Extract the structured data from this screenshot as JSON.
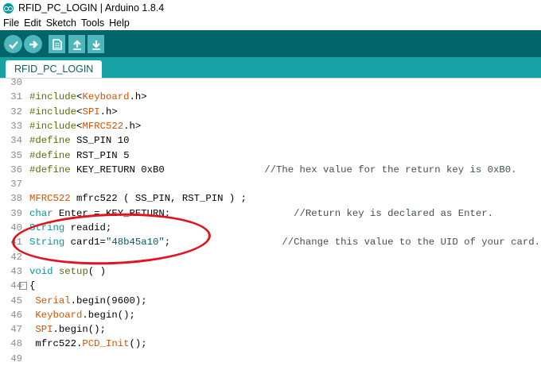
{
  "window": {
    "title": "RFID_PC_LOGIN | Arduino 1.8.4"
  },
  "menu": [
    "File",
    "Edit",
    "Sketch",
    "Tools",
    "Help"
  ],
  "toolbar": {
    "buttons": [
      {
        "name": "verify",
        "icon": "checkmark-icon"
      },
      {
        "name": "upload",
        "icon": "arrow-right-icon"
      },
      {
        "name": "new",
        "icon": "new-file-icon"
      },
      {
        "name": "open",
        "icon": "arrow-up-icon"
      },
      {
        "name": "save",
        "icon": "arrow-down-icon"
      }
    ]
  },
  "tab": {
    "label": "RFID_PC_LOGIN"
  },
  "colors": {
    "toolbar": "#006468",
    "tabbar": "#17a1a5",
    "button": "#4db7bb",
    "annotation": "#e2131f"
  },
  "editor": {
    "lines": [
      {
        "n": "30",
        "fold": "",
        "code": []
      },
      {
        "n": "31",
        "fold": "",
        "code": [
          [
            "kw",
            "#include"
          ],
          [
            "",
            "<"
          ],
          [
            "lib",
            "Keyboard"
          ],
          [
            "",
            ".h>"
          ]
        ]
      },
      {
        "n": "32",
        "fold": "",
        "code": [
          [
            "kw",
            "#include"
          ],
          [
            "",
            "<"
          ],
          [
            "lib",
            "SPI"
          ],
          [
            "",
            ".h>"
          ]
        ]
      },
      {
        "n": "33",
        "fold": "",
        "code": [
          [
            "kw",
            "#include"
          ],
          [
            "",
            "<"
          ],
          [
            "lib",
            "MFRC522"
          ],
          [
            "",
            ".h>"
          ]
        ]
      },
      {
        "n": "34",
        "fold": "",
        "code": [
          [
            "kw",
            "#define"
          ],
          [
            "",
            " SS_PIN 10"
          ]
        ]
      },
      {
        "n": "35",
        "fold": "",
        "code": [
          [
            "kw",
            "#define"
          ],
          [
            "",
            " RST_PIN 5"
          ]
        ]
      },
      {
        "n": "36",
        "fold": "",
        "code": [
          [
            "kw",
            "#define"
          ],
          [
            "",
            " KEY_RETURN 0xB0                 "
          ],
          [
            "cmt",
            "//The hex value for the return key is 0xB0."
          ]
        ]
      },
      {
        "n": "37",
        "fold": "",
        "code": []
      },
      {
        "n": "38",
        "fold": "",
        "code": [
          [
            "lib",
            "MFRC522"
          ],
          [
            "",
            " mfrc522 ( SS_PIN, RST_PIN ) ;"
          ]
        ]
      },
      {
        "n": "39",
        "fold": "",
        "code": [
          [
            "typ",
            "char"
          ],
          [
            "",
            " Enter = KEY_RETURN;                     "
          ],
          [
            "cmt",
            "//Return key is declared as Enter."
          ]
        ]
      },
      {
        "n": "40",
        "fold": "",
        "code": [
          [
            "typ",
            "String"
          ],
          [
            "",
            " readid;"
          ]
        ]
      },
      {
        "n": "41",
        "fold": "",
        "code": [
          [
            "typ",
            "String"
          ],
          [
            "",
            " card1="
          ],
          [
            "str",
            "\"48b45a10\""
          ],
          [
            "",
            ";                   "
          ],
          [
            "cmt",
            "//Change this value to the UID of your card."
          ]
        ]
      },
      {
        "n": "42",
        "fold": "",
        "code": []
      },
      {
        "n": "43",
        "fold": "",
        "code": [
          [
            "typ",
            "void"
          ],
          [
            "",
            " "
          ],
          [
            "kw",
            "setup"
          ],
          [
            "",
            "( )"
          ]
        ]
      },
      {
        "n": "44",
        "fold": "-",
        "code": [
          [
            "",
            "{"
          ]
        ]
      },
      {
        "n": "45",
        "fold": "",
        "code": [
          [
            "",
            ""
          ],
          [
            "fn",
            " Serial"
          ],
          [
            "",
            ".begin(9600);"
          ]
        ]
      },
      {
        "n": "46",
        "fold": "",
        "code": [
          [
            "fn",
            " Keyboard"
          ],
          [
            "",
            ".begin();"
          ]
        ]
      },
      {
        "n": "47",
        "fold": "",
        "code": [
          [
            "fn",
            " SPI"
          ],
          [
            "",
            ".begin();"
          ]
        ]
      },
      {
        "n": "48",
        "fold": "",
        "code": [
          [
            "",
            " mfrc522."
          ],
          [
            "fn",
            "PCD_Init"
          ],
          [
            "",
            "();"
          ]
        ]
      },
      {
        "n": "49",
        "fold": "",
        "code": [
          [
            "",
            ""
          ]
        ]
      }
    ]
  }
}
